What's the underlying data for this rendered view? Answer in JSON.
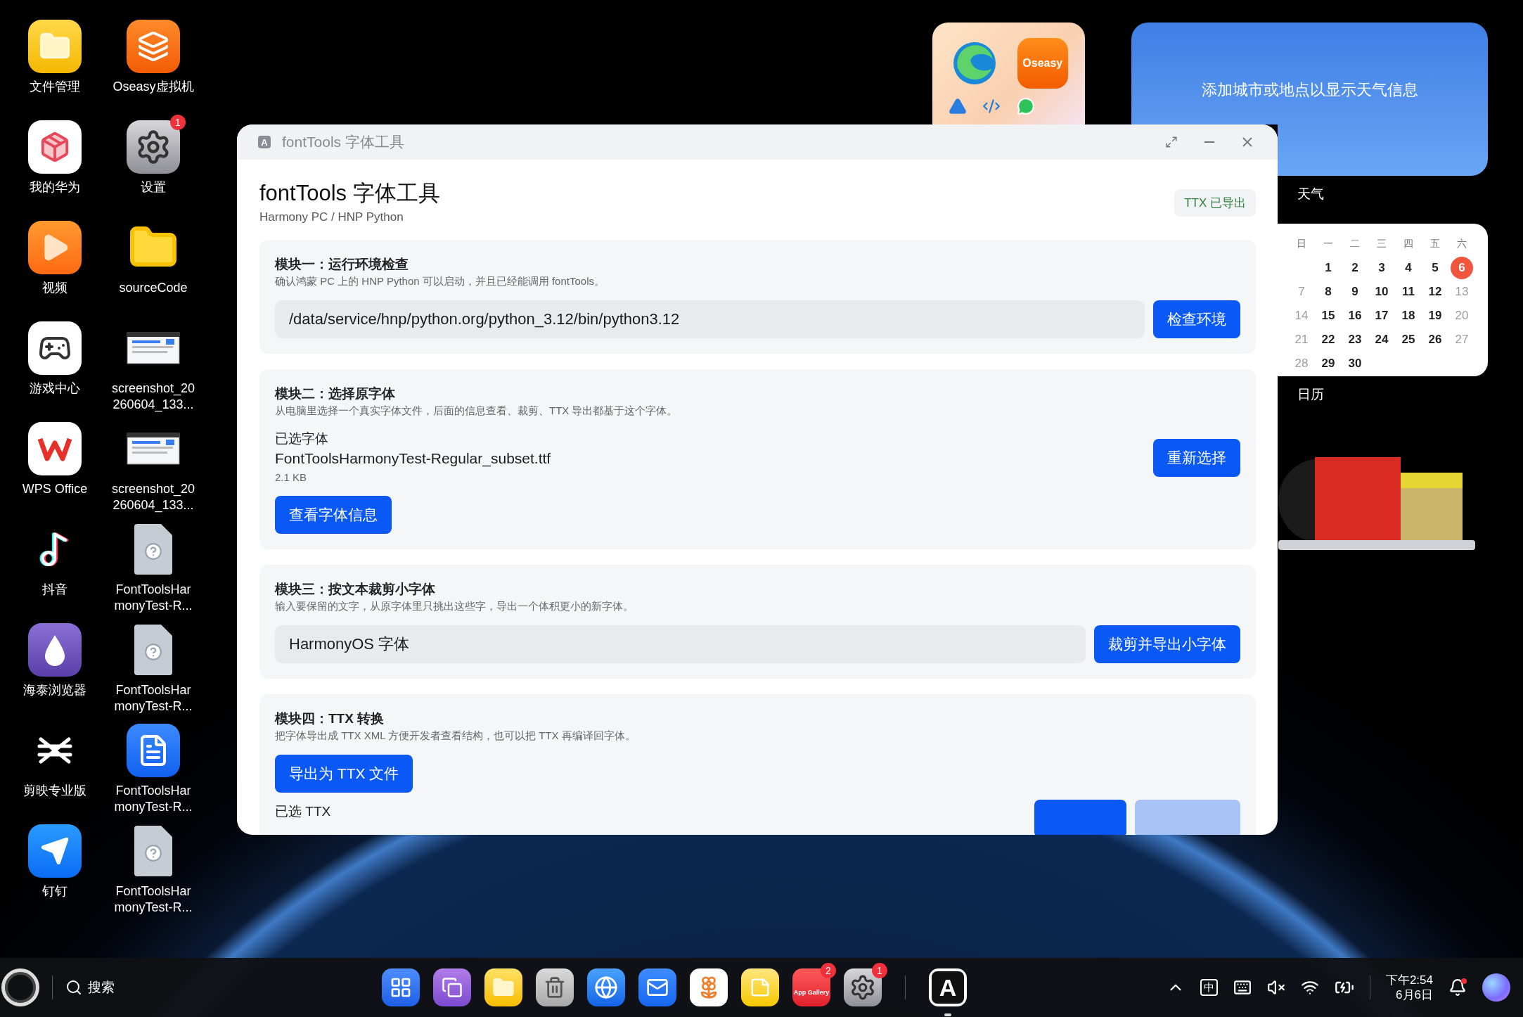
{
  "desktop": {
    "shortcuts": [
      {
        "kind": "files",
        "label": "文件管理"
      },
      {
        "kind": "huawei",
        "label": "我的华为"
      },
      {
        "kind": "video",
        "label": "视频"
      },
      {
        "kind": "games",
        "label": "游戏中心"
      },
      {
        "kind": "wps",
        "label": "WPS Office"
      },
      {
        "kind": "tiktok",
        "label": "抖音"
      },
      {
        "kind": "browser",
        "label": "海泰浏览器"
      },
      {
        "kind": "capcut",
        "label": "剪映专业版"
      },
      {
        "kind": "dingtalk",
        "label": "钉钉"
      },
      {
        "kind": "vm",
        "label": "Oseasy虚拟机"
      },
      {
        "kind": "settings",
        "label": "设置",
        "badge": "1"
      },
      {
        "kind": "folder",
        "label": "sourceCode"
      },
      {
        "kind": "screenshot",
        "label": "screenshot_20260604_133..."
      },
      {
        "kind": "screenshot",
        "label": "screenshot_20260604_133..."
      },
      {
        "kind": "unknown",
        "label": "FontToolsHarmonyTest-R..."
      },
      {
        "kind": "unknown",
        "label": "FontToolsHarmonyTest-R..."
      },
      {
        "kind": "notes",
        "label": "FontToolsHarmonyTest-R..."
      },
      {
        "kind": "unknown",
        "label": "FontToolsHarmonyTest-R..."
      }
    ]
  },
  "widgets": {
    "app_folder": {
      "apps": [
        {
          "kind": "edge"
        },
        {
          "kind": "store",
          "label": "Oseasy"
        },
        {
          "kind": "triangle"
        },
        {
          "kind": "code"
        },
        {
          "kind": "chat"
        }
      ]
    },
    "weather": {
      "message": "添加城市或地点以显示天气信息",
      "label": "天气"
    },
    "calendar": {
      "weekdays": [
        "日",
        "一",
        "二",
        "三",
        "四",
        "五",
        "六"
      ],
      "weeks": [
        {
          "days": [
            {
              "day": "1",
              "muted": false,
              "selected": false
            },
            {
              "day": "2",
              "muted": false,
              "selected": false
            },
            {
              "day": "3",
              "muted": false,
              "selected": false
            },
            {
              "day": "4",
              "muted": false,
              "selected": false
            },
            {
              "day": "5",
              "muted": false,
              "selected": false
            },
            {
              "day": "6",
              "muted": false,
              "selected": true
            }
          ]
        },
        {
          "days": [
            {
              "day": "7",
              "muted": true,
              "selected": false
            },
            {
              "day": "8",
              "muted": false,
              "selected": false
            },
            {
              "day": "9",
              "muted": false,
              "selected": false
            },
            {
              "day": "10",
              "muted": false,
              "selected": false
            },
            {
              "day": "11",
              "muted": false,
              "selected": false
            },
            {
              "day": "12",
              "muted": false,
              "selected": false
            },
            {
              "day": "13",
              "muted": true,
              "selected": false
            }
          ]
        },
        {
          "days": [
            {
              "day": "14",
              "muted": true,
              "selected": false
            },
            {
              "day": "15",
              "muted": false,
              "selected": false
            },
            {
              "day": "16",
              "muted": false,
              "selected": false
            },
            {
              "day": "17",
              "muted": false,
              "selected": false
            },
            {
              "day": "18",
              "muted": false,
              "selected": false
            },
            {
              "day": "19",
              "muted": false,
              "selected": false
            },
            {
              "day": "20",
              "muted": true,
              "selected": false
            }
          ]
        },
        {
          "days": [
            {
              "day": "21",
              "muted": true,
              "selected": false
            },
            {
              "day": "22",
              "muted": false,
              "selected": false
            },
            {
              "day": "23",
              "muted": false,
              "selected": false
            },
            {
              "day": "24",
              "muted": false,
              "selected": false
            },
            {
              "day": "25",
              "muted": false,
              "selected": false
            },
            {
              "day": "26",
              "muted": false,
              "selected": false
            },
            {
              "day": "27",
              "muted": true,
              "selected": false
            }
          ]
        },
        {
          "days": [
            {
              "day": "28",
              "muted": true,
              "selected": false
            },
            {
              "day": "29",
              "muted": false,
              "selected": false
            },
            {
              "day": "30",
              "muted": false,
              "selected": false
            }
          ]
        }
      ],
      "label": "日历"
    }
  },
  "window": {
    "title": "fontTools 字体工具",
    "app_icon": "A",
    "header": {
      "title": "fontTools 字体工具",
      "subtitle": "Harmony PC / HNP Python",
      "status": "TTX 已导出"
    },
    "modules": [
      {
        "kind": "path",
        "title": "模块一：运行环境检查",
        "description": "确认鸿蒙 PC 上的 HNP Python 可以启动，并且已经能调用 fontTools。",
        "value": "/data/service/hnp/python.org/python_3.12/bin/python3.12",
        "button": "检查环境"
      },
      {
        "kind": "file",
        "title": "模块二：选择原字体",
        "description": "从电脑里选择一个真实字体文件，后面的信息查看、裁剪、TTX 导出都基于这个字体。",
        "label": "已选字体",
        "file": "FontToolsHarmonyTest-Regular_subset.ttf",
        "size": "2.1 KB",
        "button": "重新选择",
        "secondary_button": "查看字体信息"
      },
      {
        "kind": "input",
        "title": "模块三：按文本裁剪小字体",
        "description": "输入要保留的文字，从原字体里只挑出这些字，导出一个体积更小的新字体。",
        "value": "HarmonyOS 字体",
        "button": "裁剪并导出小字体"
      },
      {
        "kind": "export",
        "title": "模块四：TTX 转换",
        "description": "把字体导出成 TTX XML 方便开发者查看结构，也可以把 TTX 再编译回字体。",
        "button": "导出为 TTX 文件",
        "label": "已选 TTX",
        "trailing_buttons": [
          {
            "disabled": false
          },
          {
            "disabled": true
          }
        ]
      }
    ]
  },
  "taskbar": {
    "search_label": "搜索",
    "dock": [
      {
        "kind": "launcher",
        "running": false
      },
      {
        "kind": "multitask",
        "running": false
      },
      {
        "kind": "files",
        "running": false
      },
      {
        "kind": "trash",
        "running": false
      },
      {
        "kind": "browser",
        "running": false
      },
      {
        "kind": "mail",
        "running": false
      },
      {
        "kind": "photos",
        "running": false
      },
      {
        "kind": "notes",
        "running": false
      },
      {
        "kind": "app-gallery",
        "label": "App Gallery",
        "badge": "2",
        "running": false
      },
      {
        "kind": "settings",
        "badge": "1",
        "running": false
      },
      {
        "kind": "fonttools",
        "label": "A",
        "running": true
      }
    ],
    "tray": [
      {
        "kind": "chevron"
      },
      {
        "kind": "ime",
        "label": "中"
      },
      {
        "kind": "keyboard"
      },
      {
        "kind": "mute"
      },
      {
        "kind": "wifi"
      },
      {
        "kind": "battery"
      }
    ],
    "time": "下午2:54",
    "date": "6月6日",
    "notification_dot": true
  }
}
